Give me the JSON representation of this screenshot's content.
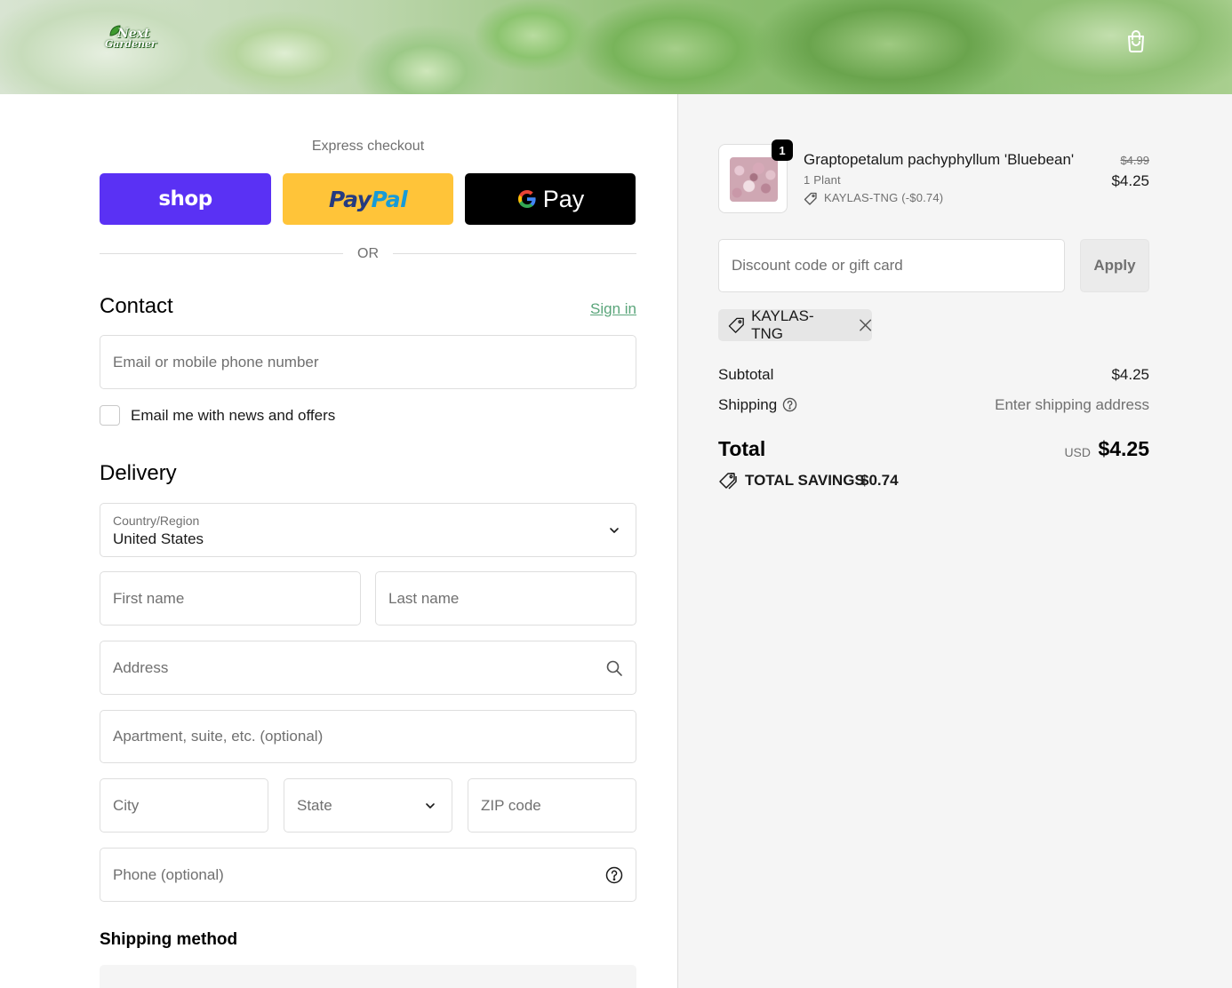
{
  "header": {
    "logo_line1": "Next",
    "logo_line2": "Gardener",
    "cart_icon": "shopping-bag-icon"
  },
  "express": {
    "label": "Express checkout",
    "shop_label": "shop",
    "paypal_label_1": "Pay",
    "paypal_label_2": "Pal",
    "gpay_label": "Pay",
    "or": "OR"
  },
  "contact": {
    "heading": "Contact",
    "sign_in": "Sign in",
    "email_placeholder": "Email or mobile phone number",
    "newsletter_label": "Email me with news and offers",
    "newsletter_checked": false
  },
  "delivery": {
    "heading": "Delivery",
    "country_label": "Country/Region",
    "country_value": "United States",
    "first_name_placeholder": "First name",
    "last_name_placeholder": "Last name",
    "address_placeholder": "Address",
    "apartment_placeholder": "Apartment, suite, etc. (optional)",
    "city_placeholder": "City",
    "state_placeholder": "State",
    "zip_placeholder": "ZIP code",
    "phone_placeholder": "Phone (optional)"
  },
  "shipping_method": {
    "heading": "Shipping method"
  },
  "summary": {
    "item": {
      "quantity": "1",
      "name": "Graptopetalum pachyphyllum 'Bluebean'",
      "variant": "1 Plant",
      "discount": "KAYLAS-TNG (-$0.74)",
      "price_original": "$4.99",
      "price_final": "$4.25"
    },
    "discount_placeholder": "Discount code or gift card",
    "apply_label": "Apply",
    "applied_code": "KAYLAS-TNG",
    "subtotal_label": "Subtotal",
    "subtotal_value": "$4.25",
    "shipping_label": "Shipping",
    "shipping_value": "Enter shipping address",
    "total_label": "Total",
    "currency": "USD",
    "total_value": "$4.25",
    "savings_label": "TOTAL SAVINGS",
    "savings_value": "$0.74"
  },
  "colors": {
    "shop": "#5a31f4",
    "paypal": "#ffc439",
    "gpay": "#000000",
    "link": "#5aa57a",
    "summary_bg": "#f5f5f5"
  }
}
